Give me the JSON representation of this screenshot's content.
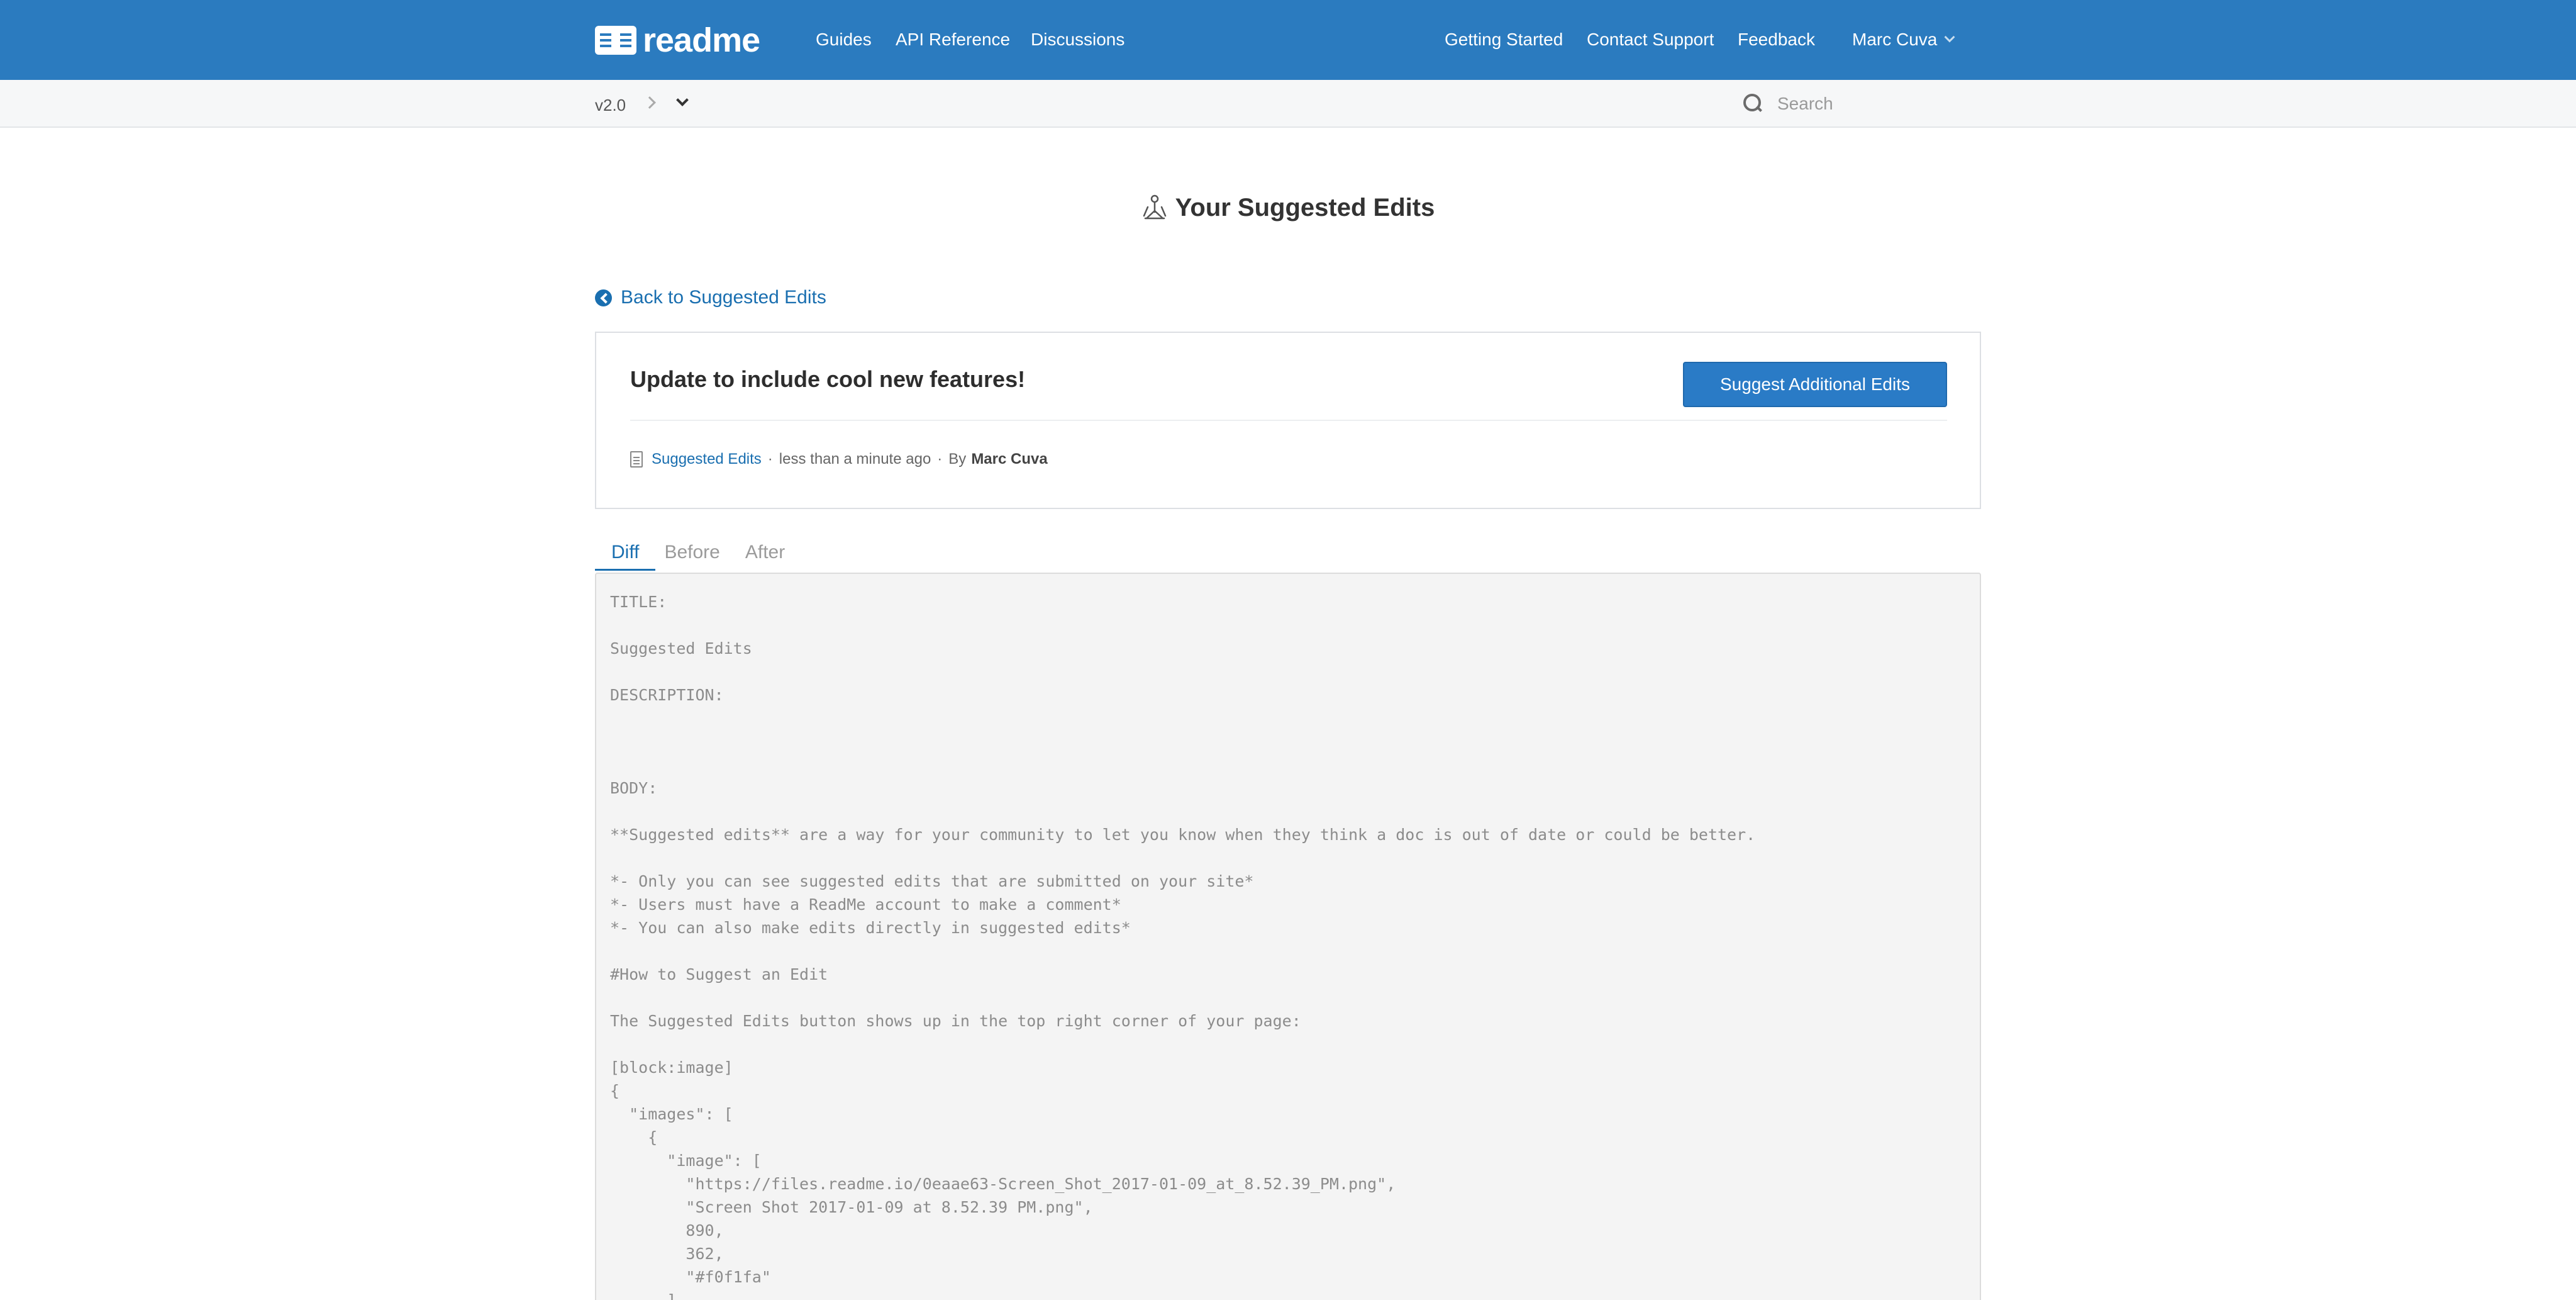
{
  "brand": {
    "name": "readme",
    "accent": "#2b7bbf",
    "link_color": "#1a6fb0"
  },
  "topnav": {
    "left": [
      "Guides",
      "API Reference",
      "Discussions"
    ],
    "right": [
      "Getting Started",
      "Contact Support",
      "Feedback"
    ],
    "user": "Marc Cuva",
    "user_icon": "chevron-down-icon"
  },
  "subnav": {
    "version": "v2.0",
    "search_placeholder": "Search"
  },
  "page": {
    "title": "Your Suggested Edits",
    "title_icon": "suggest-edits-icon",
    "back_link": "Back to Suggested Edits"
  },
  "card": {
    "title": "Update to include cool new features!",
    "button": "Suggest Additional Edits",
    "meta": {
      "doc_link": "Suggested Edits",
      "sep1": "·",
      "time": "less than a minute ago",
      "sep2": "·",
      "by_label": "By",
      "author": "Marc Cuva"
    }
  },
  "tabs": [
    "Diff",
    "Before",
    "After"
  ],
  "active_tab": "Diff",
  "diff": {
    "lines": [
      "TITLE:",
      "",
      "Suggested Edits",
      "",
      "DESCRIPTION:",
      "",
      "",
      "",
      "BODY:",
      "",
      "**Suggested edits** are a way for your community to let you know when they think a doc is out of date or could be better.",
      "",
      "*- Only you can see suggested edits that are submitted on your site*",
      "*- Users must have a ReadMe account to make a comment*",
      "*- You can also make edits directly in suggested edits*",
      "",
      "#How to Suggest an Edit",
      "",
      "The Suggested Edits button shows up in the top right corner of your page:",
      "",
      "[block:image]",
      "{",
      "  \"images\": [",
      "    {",
      "      \"image\": [",
      "        \"https://files.readme.io/0eaae63-Screen_Shot_2017-01-09_at_8.52.39_PM.png\",",
      "        \"Screen Shot 2017-01-09 at 8.52.39 PM.png\",",
      "        890,",
      "        362,",
      "        \"#f0f1fa\"",
      "      ],"
    ]
  }
}
